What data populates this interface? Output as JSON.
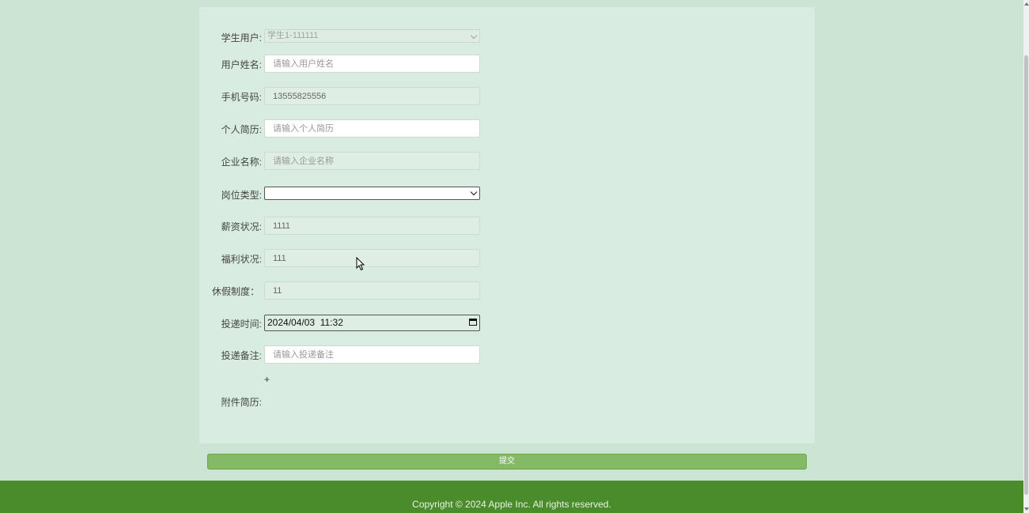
{
  "form": {
    "fields": [
      {
        "label": "学生用户:",
        "type": "select-disabled",
        "value": "学生1-111111"
      },
      {
        "label": "用户姓名:",
        "type": "input",
        "value": "",
        "placeholder": "请输入用户姓名"
      },
      {
        "label": "手机号码:",
        "type": "input-readonly",
        "value": "13555825556"
      },
      {
        "label": "个人简历:",
        "type": "input",
        "value": "",
        "placeholder": "请输入个人简历"
      },
      {
        "label": "企业名称:",
        "type": "input-readonly",
        "value": "",
        "placeholder": "请输入企业名称"
      },
      {
        "label": "岗位类型:",
        "type": "select",
        "value": ""
      },
      {
        "label": "薪资状况:",
        "type": "input-readonly",
        "value": "1111"
      },
      {
        "label": "福利状况:",
        "type": "input-readonly",
        "value": "111"
      },
      {
        "label": "休假制度：",
        "type": "input-readonly",
        "value": "11"
      },
      {
        "label": "投递时间:",
        "type": "datetime",
        "value": "2024/04/03  11:32"
      },
      {
        "label": "投递备注:",
        "type": "input",
        "value": "",
        "placeholder": "请输入投递备注"
      }
    ],
    "upload_plus": "+",
    "attachment_label": "附件简历:",
    "submit_label": "提交"
  },
  "footer": {
    "copyright": "Copyright © 2024 Apple Inc. All rights reserved."
  },
  "icons": {
    "dropdown": "chevron-down-icon",
    "calendar": "calendar-icon"
  },
  "colors": {
    "page_bg": "#cbe4d3",
    "panel_bg": "#d8ece1",
    "submit_bg": "#84b965",
    "footer_bg": "#4a8c2c"
  }
}
